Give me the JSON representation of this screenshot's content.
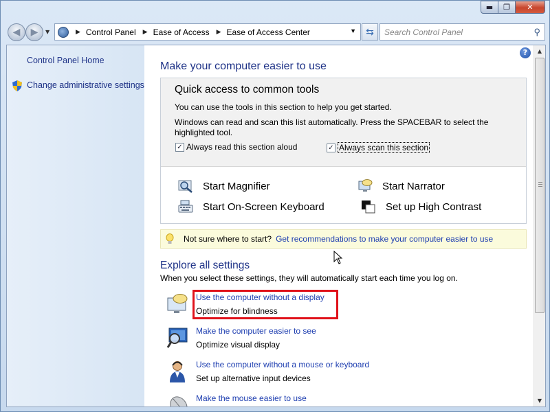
{
  "window": {
    "caption_min": "▬",
    "caption_max": "❐",
    "caption_close": "✕"
  },
  "address": {
    "crumbs": [
      "Control Panel",
      "Ease of Access",
      "Ease of Access Center"
    ]
  },
  "search": {
    "placeholder": "Search Control Panel"
  },
  "sidebar": {
    "home_link": "Control Panel Home",
    "admin_link": "Change administrative settings"
  },
  "main": {
    "heading": "Make your computer easier to use",
    "quick_access": {
      "title": "Quick access to common tools",
      "line1": "You can use the tools in this section to help you get started.",
      "line2": "Windows can read and scan this list automatically.  Press the SPACEBAR to select the",
      "line3": "highlighted tool.",
      "read_aloud": "Always read this section aloud",
      "scan": "Always scan this section",
      "tools": {
        "magnifier": "Start Magnifier",
        "narrator": "Start Narrator",
        "keyboard": "Start On-Screen Keyboard",
        "contrast": "Set up High Contrast"
      }
    },
    "tip": {
      "prefix": "Not sure where to start?",
      "link": "Get recommendations to make your computer easier to use"
    },
    "explore": {
      "heading": "Explore all settings",
      "desc": "When you select these settings, they will automatically start each time you log on.",
      "items": [
        {
          "link": "Use the computer without a display",
          "sub": "Optimize for blindness",
          "icon": "speech-display-icon"
        },
        {
          "link": "Make the computer easier to see",
          "sub": "Optimize visual display",
          "icon": "magnify-display-icon"
        },
        {
          "link": "Use the computer without a mouse or keyboard",
          "sub": "Set up alternative input devices",
          "icon": "person-headset-icon"
        },
        {
          "link": "Make the mouse easier to use",
          "sub": "",
          "icon": "mouse-icon"
        }
      ]
    }
  },
  "colors": {
    "link": "#1e3eb0",
    "heading": "#1e3287",
    "highlight": "#e0121a"
  }
}
